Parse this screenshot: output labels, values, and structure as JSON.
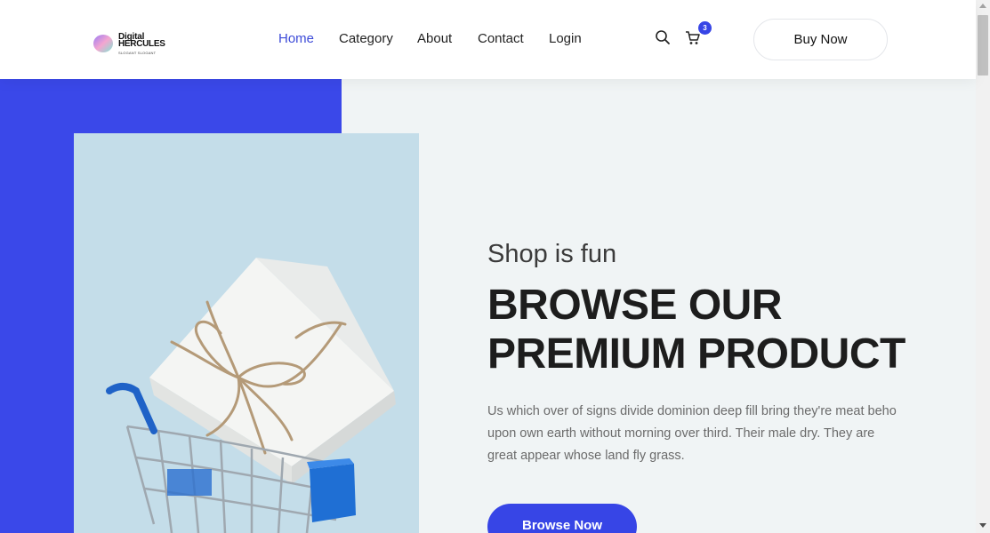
{
  "header": {
    "logo": {
      "line1": "Digital",
      "line2": "HERCULES",
      "line3": "SLOGANT SLOGANT"
    },
    "nav": [
      {
        "label": "Home",
        "active": true
      },
      {
        "label": "Category",
        "active": false
      },
      {
        "label": "About",
        "active": false
      },
      {
        "label": "Contact",
        "active": false
      },
      {
        "label": "Login",
        "active": false
      }
    ],
    "icons": {
      "search": "search-icon",
      "cart": "cart-icon"
    },
    "cart_count": "3",
    "buy_button": "Buy Now"
  },
  "hero": {
    "tagline": "Shop is fun",
    "headline": "BROWSE OUR PREMIUM PRODUCT",
    "description": "Us which over of signs divide dominion deep fill bring they're meat beho upon own earth without morning over third. Their male dry. They are great appear whose land fly grass.",
    "cta": "Browse Now"
  },
  "colors": {
    "accent": "#3745e6",
    "active_nav": "#3d4bd8",
    "hero_background": "#f0f4f5",
    "image_background": "#c4dde9"
  }
}
